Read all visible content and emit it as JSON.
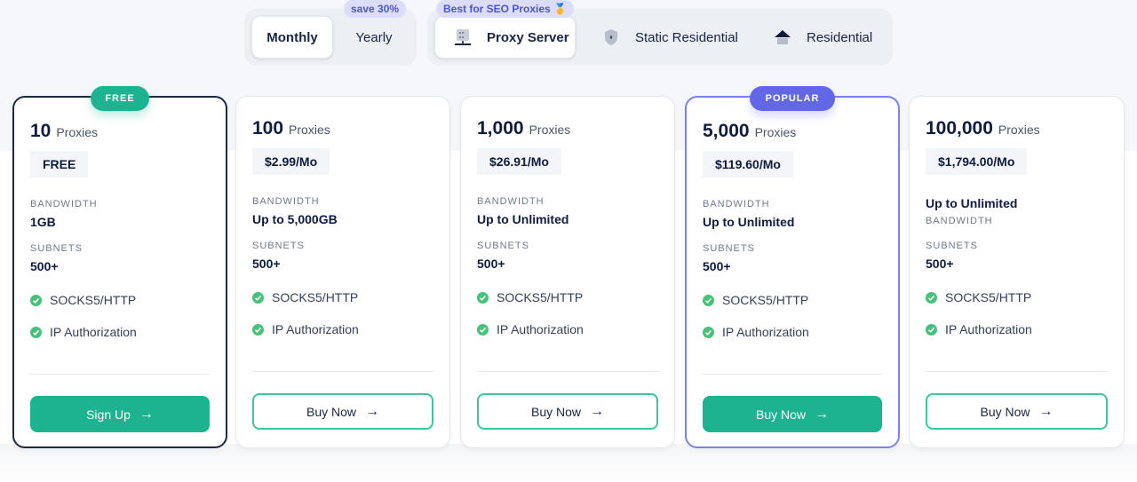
{
  "billing": {
    "options": [
      {
        "label": "Monthly",
        "active": true
      },
      {
        "label": "Yearly",
        "active": false
      }
    ],
    "save_badge": "save 30%"
  },
  "proxy_types": {
    "badge": "Best for SEO Proxies 🥇",
    "options": [
      {
        "label": "Proxy Server",
        "icon": "server-icon",
        "active": true
      },
      {
        "label": "Static Residential",
        "icon": "shield-icon",
        "active": false
      },
      {
        "label": "Residential",
        "icon": "house-icon",
        "active": false
      }
    ]
  },
  "colors": {
    "accent_green": "#1db391",
    "accent_purple": "#6267e6",
    "check_green": "#49c17a",
    "text_dark": "#0f1b3d"
  },
  "plans": [
    {
      "badge": "FREE",
      "count": "10",
      "unit": "Proxies",
      "price": "FREE",
      "bandwidth_label": "BANDWIDTH",
      "bandwidth": "1GB",
      "subnets_label": "SUBNETS",
      "subnets": "500+",
      "features": [
        "SOCKS5/HTTP",
        "IP Authorization"
      ],
      "cta": "Sign Up",
      "cta_arrow": "→"
    },
    {
      "count": "100",
      "unit": "Proxies",
      "price": "$2.99/Mo",
      "bandwidth_label": "BANDWIDTH",
      "bandwidth": "Up to 5,000GB",
      "subnets_label": "SUBNETS",
      "subnets": "500+",
      "features": [
        "SOCKS5/HTTP",
        "IP Authorization"
      ],
      "cta": "Buy Now",
      "cta_arrow": "→"
    },
    {
      "count": "1,000",
      "unit": "Proxies",
      "price": "$26.91/Mo",
      "bandwidth_label": "BANDWIDTH",
      "bandwidth": "Up to Unlimited",
      "subnets_label": "SUBNETS",
      "subnets": "500+",
      "features": [
        "SOCKS5/HTTP",
        "IP Authorization"
      ],
      "cta": "Buy Now",
      "cta_arrow": "→"
    },
    {
      "badge": "POPULAR",
      "count": "5,000",
      "unit": "Proxies",
      "price": "$119.60/Mo",
      "bandwidth_label": "BANDWIDTH",
      "bandwidth": "Up to Unlimited",
      "subnets_label": "SUBNETS",
      "subnets": "500+",
      "features": [
        "SOCKS5/HTTP",
        "IP Authorization"
      ],
      "cta": "Buy Now",
      "cta_arrow": "→"
    },
    {
      "count": "100,000",
      "unit": "Proxies",
      "price": "$1,794.00/Mo",
      "bandwidth_label": "BANDWIDTH",
      "bandwidth": "Up to Unlimited",
      "subnets_label": "SUBNETS",
      "subnets": "500+",
      "features": [
        "SOCKS5/HTTP",
        "IP Authorization"
      ],
      "cta": "Buy Now",
      "cta_arrow": "→"
    }
  ]
}
